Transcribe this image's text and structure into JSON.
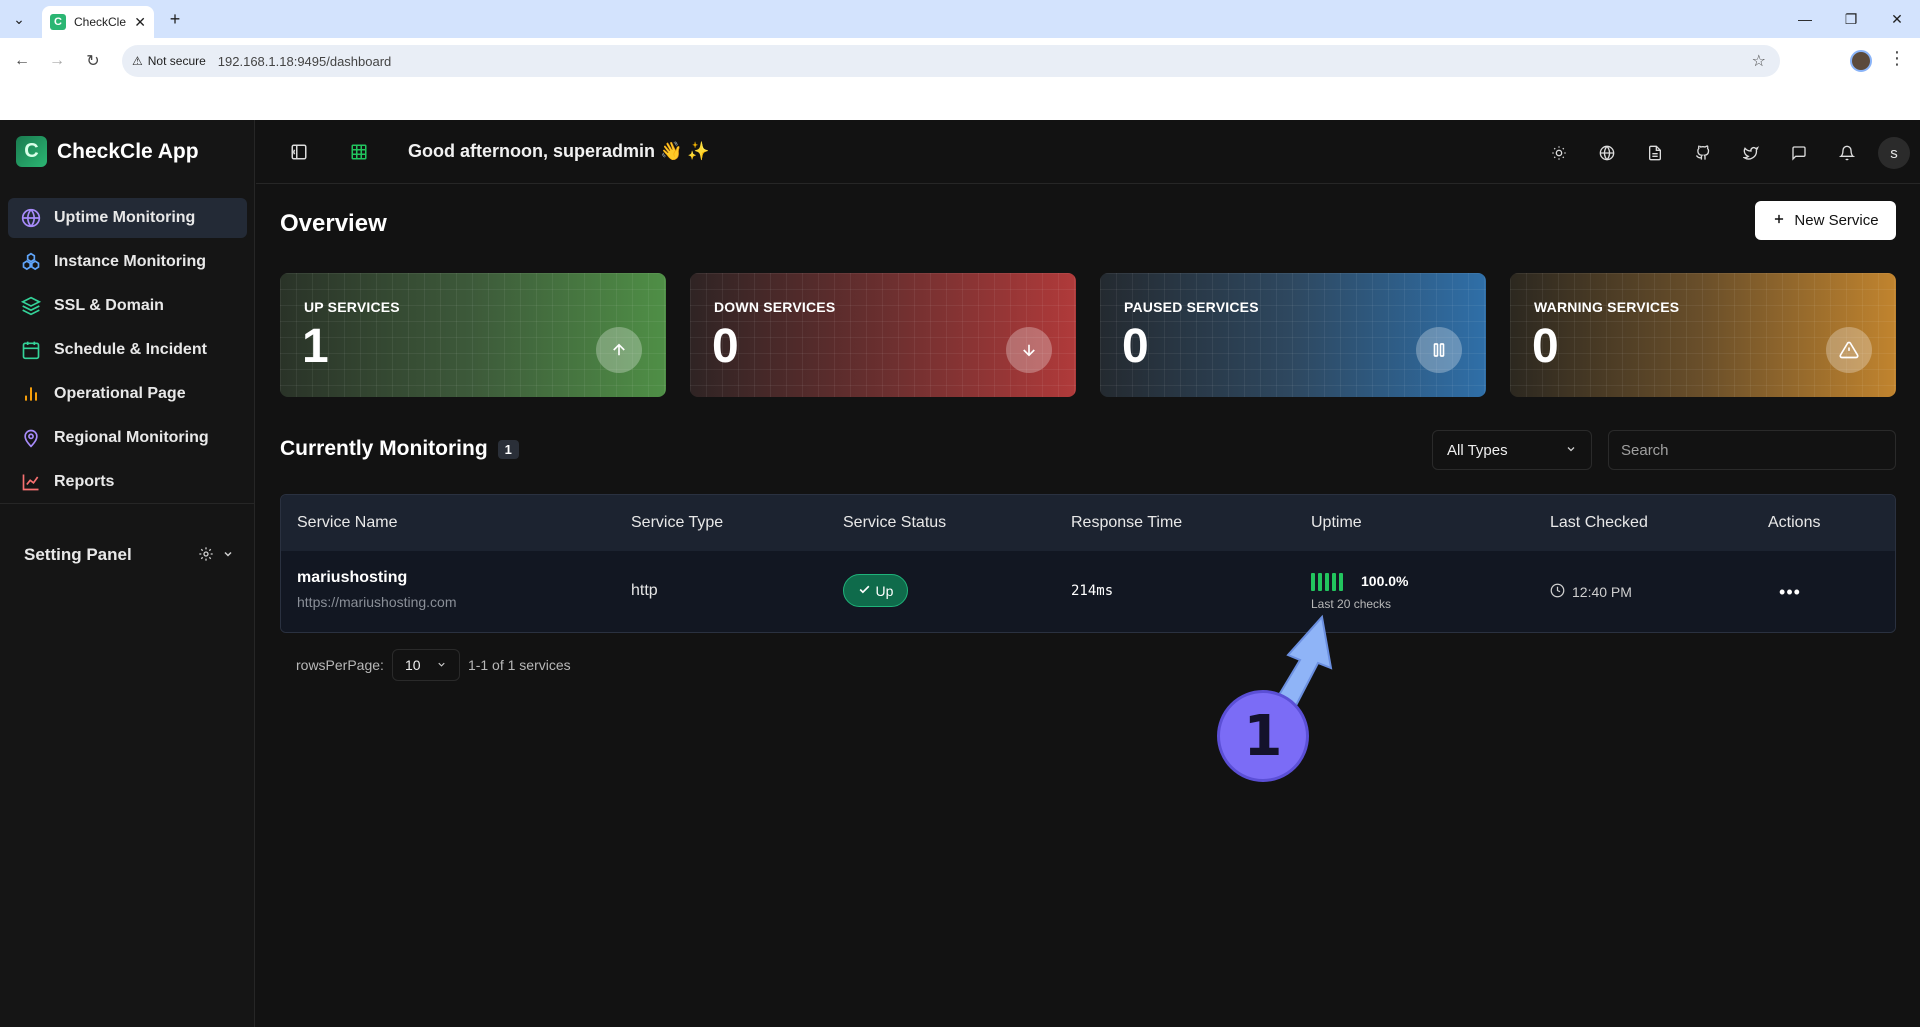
{
  "browser": {
    "tab_title": "CheckCle App",
    "security_label": "Not secure",
    "url": "192.168.1.18:9495/dashboard"
  },
  "app": {
    "brand": "CheckCle App",
    "greeting": "Good afternoon, superadmin 👋 ✨",
    "avatar_letter": "s"
  },
  "sidebar": {
    "items": [
      {
        "label": "Uptime Monitoring",
        "icon": "globe-icon",
        "color": "#a78bfa",
        "active": true
      },
      {
        "label": "Instance Monitoring",
        "icon": "boxes-icon",
        "color": "#60a5fa",
        "active": false
      },
      {
        "label": "SSL & Domain",
        "icon": "layers-icon",
        "color": "#34d399",
        "active": false
      },
      {
        "label": "Schedule & Incident",
        "icon": "calendar-icon",
        "color": "#34d399",
        "active": false
      },
      {
        "label": "Operational Page",
        "icon": "bar-chart-icon",
        "color": "#f59e0b",
        "active": false
      },
      {
        "label": "Regional Monitoring",
        "icon": "map-pin-icon",
        "color": "#a78bfa",
        "active": false
      },
      {
        "label": "Reports",
        "icon": "line-chart-icon",
        "color": "#f87171",
        "active": false
      }
    ],
    "setting_panel": "Setting Panel"
  },
  "overview": {
    "title": "Overview",
    "new_service_label": "New Service",
    "cards": [
      {
        "label": "UP SERVICES",
        "value": "1",
        "icon": "arrow-up-icon"
      },
      {
        "label": "DOWN SERVICES",
        "value": "0",
        "icon": "arrow-down-icon"
      },
      {
        "label": "PAUSED SERVICES",
        "value": "0",
        "icon": "pause-icon"
      },
      {
        "label": "WARNING SERVICES",
        "value": "0",
        "icon": "warning-icon"
      }
    ]
  },
  "monitoring": {
    "title": "Currently Monitoring",
    "count": "1",
    "type_filter": "All Types",
    "search_placeholder": "Search",
    "columns": [
      "Service Name",
      "Service Type",
      "Service Status",
      "Response Time",
      "Uptime",
      "Last Checked",
      "Actions"
    ],
    "rows": [
      {
        "name": "mariushosting",
        "url": "https://mariushosting.com",
        "type": "http",
        "status": "Up",
        "response_time": "214ms",
        "uptime": "100.0%",
        "uptime_sub": "Last 20 checks",
        "last_checked": "12:40 PM"
      }
    ],
    "rows_per_page_label": "rowsPerPage:",
    "rows_per_page": "10",
    "range_text": "1-1 of 1 services"
  },
  "annotation": {
    "number": "1",
    "color": "#7b6cf6"
  }
}
